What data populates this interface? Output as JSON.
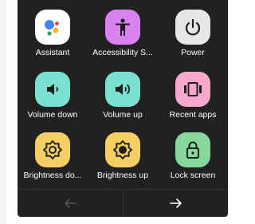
{
  "menu": {
    "tiles": [
      {
        "label": "Assistant",
        "icon": "google-assistant-icon",
        "color": "#ffffff"
      },
      {
        "label": "Accessibility S...",
        "icon": "accessibility-icon",
        "color": "#d982f2"
      },
      {
        "label": "Power",
        "icon": "power-icon",
        "color": "#e6e6e6"
      },
      {
        "label": "Volume down",
        "icon": "volume-down-icon",
        "color": "#7be0cf"
      },
      {
        "label": "Volume up",
        "icon": "volume-up-icon",
        "color": "#7be0cf"
      },
      {
        "label": "Recent apps",
        "icon": "recent-apps-icon",
        "color": "#f7a8cc"
      },
      {
        "label": "Brightness do...",
        "icon": "brightness-down-icon",
        "color": "#f5cf61"
      },
      {
        "label": "Brightness up",
        "icon": "brightness-up-icon",
        "color": "#f5cf61"
      },
      {
        "label": "Lock screen",
        "icon": "lock-screen-icon",
        "color": "#86d79a"
      }
    ],
    "nav": {
      "prev_icon": "arrow-left-icon",
      "next_icon": "arrow-right-icon",
      "prev_enabled": false,
      "next_enabled": true
    }
  },
  "colors": {
    "panel_background": "#212121",
    "label_text": "#ffffff",
    "icon_glyph": "#1e1e1e",
    "disabled_arrow": "#555555",
    "enabled_arrow": "#ffffff"
  }
}
